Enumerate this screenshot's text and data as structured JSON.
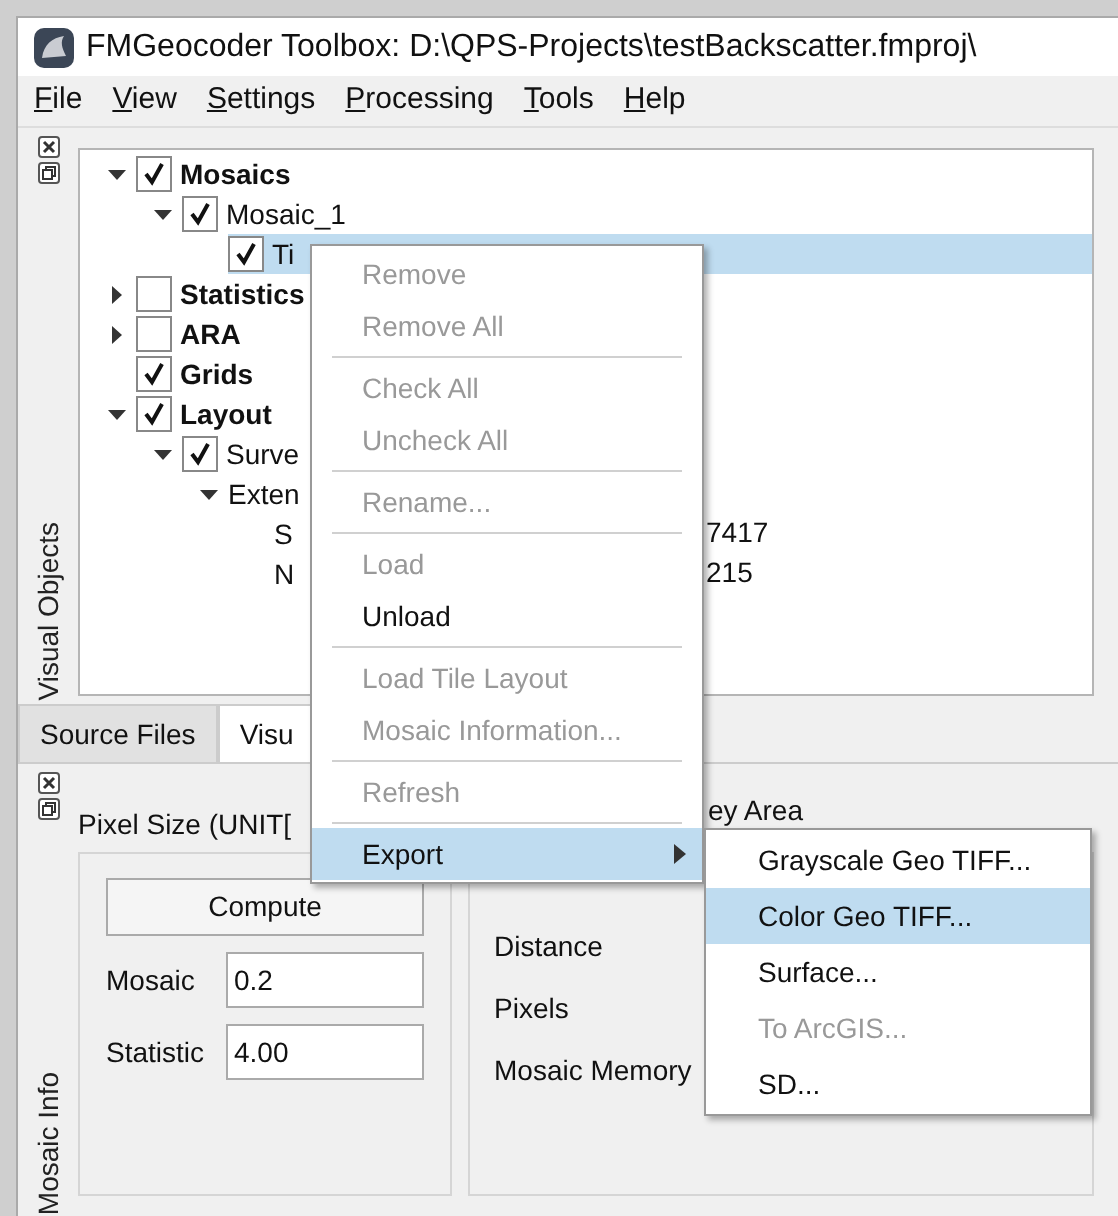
{
  "window": {
    "title": "FMGeocoder Toolbox: D:\\QPS-Projects\\testBackscatter.fmproj\\"
  },
  "menu_bar": [
    "File",
    "View",
    "Settings",
    "Processing",
    "Tools",
    "Help"
  ],
  "visual_objects": {
    "title": "Visual Objects",
    "tree": [
      {
        "label": "Mosaics",
        "checked": true,
        "expanded": true,
        "selected": false,
        "children": [
          {
            "label": "Mosaic_1",
            "checked": true,
            "expanded": true,
            "selected": false,
            "children": [
              {
                "label": "Ti",
                "checked": true,
                "selected": true
              }
            ]
          }
        ]
      },
      {
        "label": "Statistics",
        "checked": false,
        "expanded": false,
        "selected": false
      },
      {
        "label": "ARA",
        "checked": false,
        "expanded": false,
        "selected": false
      },
      {
        "label": "Grids",
        "checked": true,
        "selected": false
      },
      {
        "label": "Layout",
        "checked": true,
        "expanded": true,
        "selected": false,
        "children": [
          {
            "label": "Surve",
            "checked": true,
            "expanded": true,
            "selected": false,
            "children": [
              {
                "label": "Exten",
                "expanded": true,
                "selected": false,
                "children": [
                  {
                    "label": "S",
                    "value": "7417",
                    "selected": false
                  },
                  {
                    "label": "N",
                    "value": "215",
                    "selected": false
                  }
                ]
              }
            ]
          }
        ]
      }
    ]
  },
  "tabs": [
    {
      "label": "Source Files",
      "selected": false
    },
    {
      "label": "Visu",
      "selected": true
    }
  ],
  "mosaic_info": {
    "title": "Mosaic Info",
    "pixel_size_group": {
      "title": "Pixel Size (UNIT[",
      "button": "Compute",
      "fields": [
        {
          "label": "Mosaic",
          "value": "0.2"
        },
        {
          "label": "Statistic",
          "value": "4.00"
        }
      ]
    },
    "area_group": {
      "title": "ey Area",
      "labels": [
        "Distance",
        "Pixels",
        "Mosaic Memory"
      ]
    }
  },
  "context_menu": {
    "items": [
      {
        "kind": "item",
        "label": "Remove",
        "disabled": true,
        "selected": false
      },
      {
        "kind": "item",
        "label": "Remove All",
        "disabled": true,
        "selected": false
      },
      {
        "kind": "separator"
      },
      {
        "kind": "item",
        "label": "Check All",
        "disabled": true,
        "selected": false
      },
      {
        "kind": "item",
        "label": "Uncheck All",
        "disabled": true,
        "selected": false
      },
      {
        "kind": "separator"
      },
      {
        "kind": "item",
        "label": "Rename...",
        "disabled": true,
        "selected": false
      },
      {
        "kind": "separator"
      },
      {
        "kind": "item",
        "label": "Load",
        "disabled": true,
        "selected": false
      },
      {
        "kind": "item",
        "label": "Unload",
        "disabled": false,
        "selected": false
      },
      {
        "kind": "separator"
      },
      {
        "kind": "item",
        "label": "Load Tile Layout",
        "disabled": true,
        "selected": false
      },
      {
        "kind": "item",
        "label": "Mosaic Information...",
        "disabled": true,
        "selected": false
      },
      {
        "kind": "separator"
      },
      {
        "kind": "item",
        "label": "Refresh",
        "disabled": true,
        "selected": false
      },
      {
        "kind": "separator"
      },
      {
        "kind": "submenu",
        "label": "Export",
        "disabled": false,
        "selected": true
      }
    ]
  },
  "export_submenu": {
    "items": [
      {
        "label": "Grayscale Geo TIFF...",
        "disabled": false,
        "selected": false
      },
      {
        "label": "Color Geo TIFF...",
        "disabled": false,
        "selected": true
      },
      {
        "label": "Surface...",
        "disabled": false,
        "selected": false
      },
      {
        "label": "To ArcGIS...",
        "disabled": true,
        "selected": false
      },
      {
        "label": "SD...",
        "disabled": false,
        "selected": false
      }
    ]
  }
}
